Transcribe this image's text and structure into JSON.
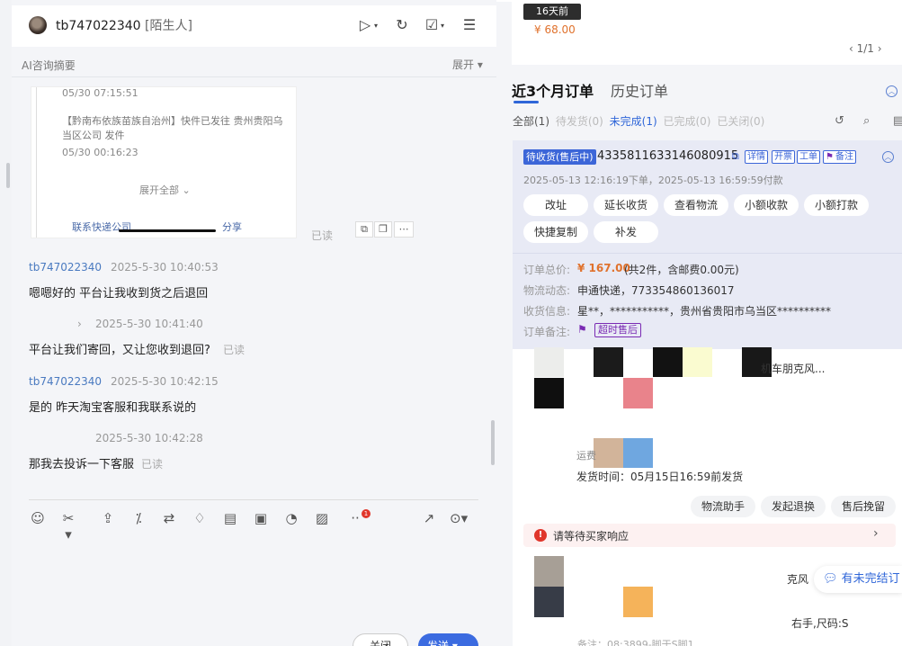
{
  "header": {
    "username": "tb747022340",
    "relation": "[陌生人]"
  },
  "ai_summary": {
    "label": "AI咨询摘要",
    "expand": "展开 ▾"
  },
  "logistics_card": {
    "time1": "05/30 07:15:51",
    "body": "【黔南布依族苗族自治州】快件已发往 贵州贵阳乌当区公司 发件",
    "time2": "05/30 00:16:23",
    "expand_all": "展开全部 ⌄",
    "company": "联系快递公司",
    "share": "分享"
  },
  "messages": [
    {
      "type": "read",
      "text": "已读"
    },
    {
      "type": "in",
      "name": "tb747022340",
      "time": "2025-5-30 10:40:53",
      "text": "嗯嗯好的 平台让我收到货之后退回"
    },
    {
      "type": "out",
      "time": "2025-5-30 10:41:40",
      "text": "平台让我们寄回，又让您收到退回?",
      "status": "已读"
    },
    {
      "type": "in",
      "name": "tb747022340",
      "time": "2025-5-30 10:42:15",
      "text": "是的 昨天淘宝客服和我联系说的"
    },
    {
      "type": "out",
      "time": "2025-5-30 10:42:28",
      "text": "那我去投诉一下客服",
      "status": "已读"
    }
  ],
  "toolbar": {
    "badge": "1",
    "close": "关闭",
    "send": "发送 ▾"
  },
  "top_card": {
    "days": "16天前",
    "price": "¥ 68.00",
    "pager": "‹  1/1  ›"
  },
  "orders": {
    "tab_recent": "近3个月订单",
    "tab_history": "历史订单",
    "filters": [
      {
        "label": "全部(1)",
        "color": "#555"
      },
      {
        "label": "待发货(0)",
        "color": "#bbb"
      },
      {
        "label": "未完成(1)",
        "color": "#2f66d8"
      },
      {
        "label": "已完成(0)",
        "color": "#bbb"
      },
      {
        "label": "已关闭(0)",
        "color": "#bbb"
      }
    ],
    "status": "待收货(售后中)",
    "order_no": "4335811633146080915",
    "tags": [
      "详情",
      "开票",
      "工单",
      "备注"
    ],
    "dates": "2025-05-13 12:16:19下单，2025-05-13 16:59:59付款",
    "actions": [
      "改址",
      "延长收货",
      "查看物流",
      "小额收款",
      "小额打款",
      "快捷复制",
      "补发"
    ],
    "total_label": "订单总价:",
    "total_price": "¥ 167.00",
    "total_extra": "(共2件，含邮费0.00元)",
    "logistics_label": "物流动态:",
    "logistics_value": "申通快递，773354860136017",
    "address_label": "收货信息:",
    "address_value": "星**，***********，贵州省贵阳市乌当区**********",
    "remark_label": "订单备注:",
    "remark_tag": "超时售后",
    "product1": "机车朋克风...",
    "ship_sub": "运费",
    "ship_time": "发货时间：05月15日16:59前发货",
    "item_actions": [
      "物流助手",
      "发起退换",
      "售后挽留"
    ],
    "waiting": "请等待买家响应",
    "product2a": "克风",
    "product2b": "右手,尺码:S",
    "product2c": "备注：08:3899-脚于S脚1…",
    "unfinished": "有未完结订"
  },
  "colors": {
    "accent": "#2f66d8",
    "price": "#e0722d",
    "alert": "#e0362b"
  }
}
